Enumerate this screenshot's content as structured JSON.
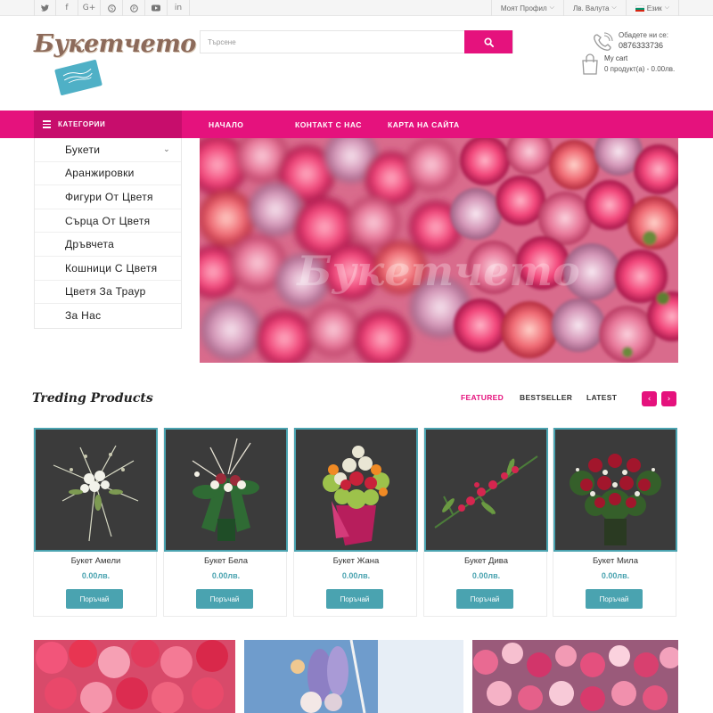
{
  "topbar": {
    "social": [
      {
        "name": "twitter-icon",
        "glyph": "🐦"
      },
      {
        "name": "facebook-icon",
        "glyph": "f"
      },
      {
        "name": "google-plus-icon",
        "glyph": "G+"
      },
      {
        "name": "skype-icon",
        "glyph": "S"
      },
      {
        "name": "pinterest-icon",
        "glyph": "P"
      },
      {
        "name": "youtube-icon",
        "glyph": "▶"
      },
      {
        "name": "linkedin-icon",
        "glyph": "in"
      }
    ],
    "profile_label": "Моят Профил",
    "currency_label": "Лв. Валута",
    "language_label": "Език"
  },
  "header": {
    "logo_text": "Букетчето",
    "logo_tag": "",
    "search_placeholder": "Търсене",
    "phone_label": "Обадете ни се:",
    "phone_number": "0876333736",
    "cart_label": "My cart",
    "cart_summary": "0 продукт(а) - 0.00лв."
  },
  "nav": {
    "categories_label": "КАТЕГОРИИ",
    "links": [
      "НАЧАЛО",
      "КОНТАКТ С НАС",
      "КАРТА НА САЙТА"
    ]
  },
  "categories": [
    {
      "label": "Букети",
      "has_sub": true
    },
    {
      "label": "Аранжировки"
    },
    {
      "label": "Фигури От Цветя"
    },
    {
      "label": "Сърца От Цветя"
    },
    {
      "label": "Дръвчета"
    },
    {
      "label": "Кошници С Цветя"
    },
    {
      "label": "Цветя За Траур"
    },
    {
      "label": "За Нас"
    }
  ],
  "banner": {
    "watermark": "Букетчето"
  },
  "products_section": {
    "title": "Treding Products",
    "tabs": [
      "FEATURED",
      "BESTSELLER",
      "LATEST"
    ],
    "active_tab": "FEATURED",
    "items": [
      {
        "name": "Букет Амели",
        "price": "0.00лв.",
        "button": "Поръчай"
      },
      {
        "name": "Букет Бела",
        "price": "0.00лв.",
        "button": "Поръчай"
      },
      {
        "name": "Букет Жана",
        "price": "0.00лв.",
        "button": "Поръчай"
      },
      {
        "name": "Букет Дива",
        "price": "0.00лв.",
        "button": "Поръчай"
      },
      {
        "name": "Букет Мила",
        "price": "0.00лв.",
        "button": "Поръчай"
      }
    ]
  },
  "colors": {
    "accent": "#e5127d",
    "teal": "#4aa3b0",
    "dark_accent": "#c70d6c"
  }
}
